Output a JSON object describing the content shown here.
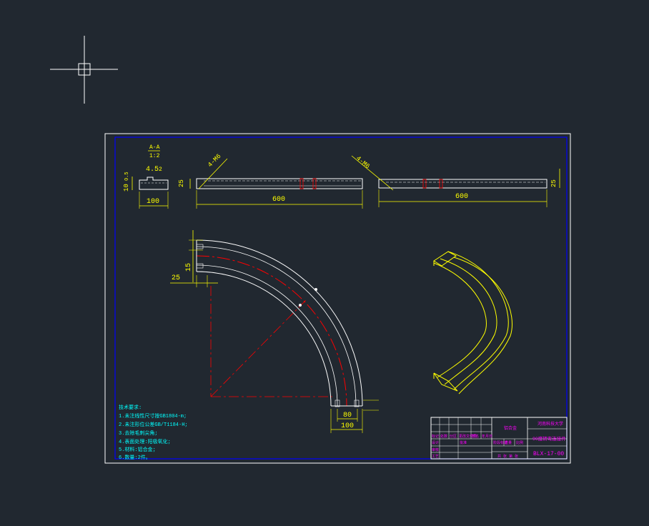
{
  "colors": {
    "background": "#212830",
    "sheet_border": "#ffffff",
    "frame": "#0000ff",
    "part_outline": "#ffffff",
    "dimension": "#ffff00",
    "centerline": "#ff0000",
    "notes": "#00ffff",
    "title_block_text": "#ff00ff",
    "iso_view": "#ffff00"
  },
  "cursor": {
    "icon": "crosshair-cursor-icon"
  },
  "section_view": {
    "label_top": "A-A",
    "label_bottom": "1:2",
    "dim_top": "4.5",
    "dim_top_small": "2",
    "dim_height": "10",
    "dim_height_small": "0.5",
    "dim_width": "100"
  },
  "front_view": {
    "dim_height": "25",
    "thread_label": "4-M6",
    "dim_length": "600"
  },
  "side_view": {
    "thread_label": "4-M6",
    "dim_length": "600",
    "dim_height": "25"
  },
  "plan_view": {
    "dim_15": "15",
    "dim_25": "25",
    "dim_80": "80",
    "dim_100": "100"
  },
  "notes": {
    "title": "技术要求:",
    "items": [
      "1.未注线性尺寸按GB1804-m;",
      "2.未注形位公差GB/T1184-H;",
      "3.去除毛刺尖角;",
      "4.表面处理:阳极氧化;",
      "5.材料:铝合金;",
      "6.数量:2件。"
    ]
  },
  "title_block": {
    "school": "河南科技大学",
    "part_name": "90度转弯连接件",
    "drawing_no": "BLX-17-00",
    "material": "铝合金",
    "scale_label": "比例",
    "sheet_label": "共 张 第 张",
    "row_labels": [
      "设计",
      "审核",
      "工艺",
      "批准"
    ],
    "mid_labels": [
      "标记",
      "处数",
      "分区",
      "更改文件号",
      "签名",
      "年月日"
    ],
    "stage_label": "阶段标记",
    "weight_label": "重量"
  }
}
